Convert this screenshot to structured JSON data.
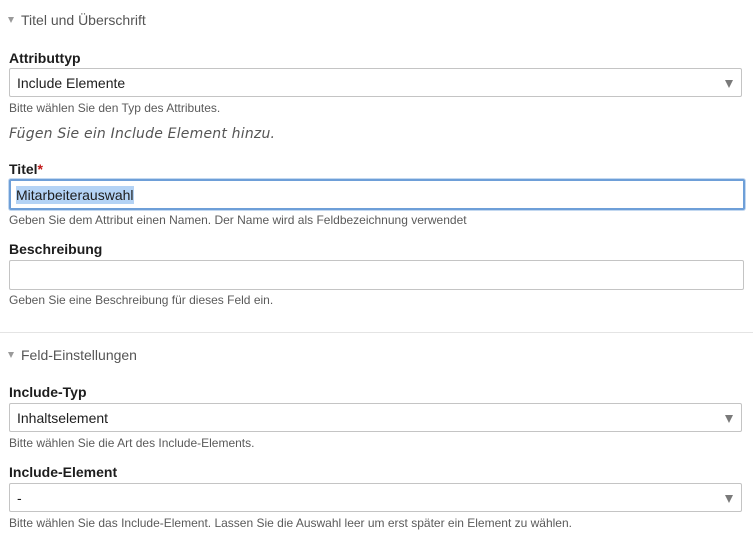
{
  "section_title": {
    "label": "Titel und Überschrift"
  },
  "attributtyp": {
    "label": "Attributtyp",
    "value": "Include Elemente",
    "help": "Bitte wählen Sie den Typ des Attributes."
  },
  "note": "Fügen Sie ein Include Element hinzu.",
  "titel": {
    "label": "Titel",
    "required_mark": "*",
    "value": "Mitarbeiterauswahl",
    "help": "Geben Sie dem Attribut einen Namen. Der Name wird als Feldbezeichnung verwendet"
  },
  "beschreibung": {
    "label": "Beschreibung",
    "value": "",
    "help": "Geben Sie eine Beschreibung für dieses Feld ein."
  },
  "section_field": {
    "label": "Feld-Einstellungen"
  },
  "include_typ": {
    "label": "Include-Typ",
    "value": "Inhaltselement",
    "help": "Bitte wählen Sie die Art des Include-Elements."
  },
  "include_element": {
    "label": "Include-Element",
    "value": "-",
    "help": "Bitte wählen Sie das Include-Element. Lassen Sie die Auswahl leer um erst später ein Element zu wählen."
  },
  "icons": {
    "collapse": "triangle-down-icon",
    "dropdown": "caret-down-icon"
  },
  "colors": {
    "required": "#c21818",
    "focus_border": "#6e9fd8",
    "selection": "#b4d3f5"
  }
}
